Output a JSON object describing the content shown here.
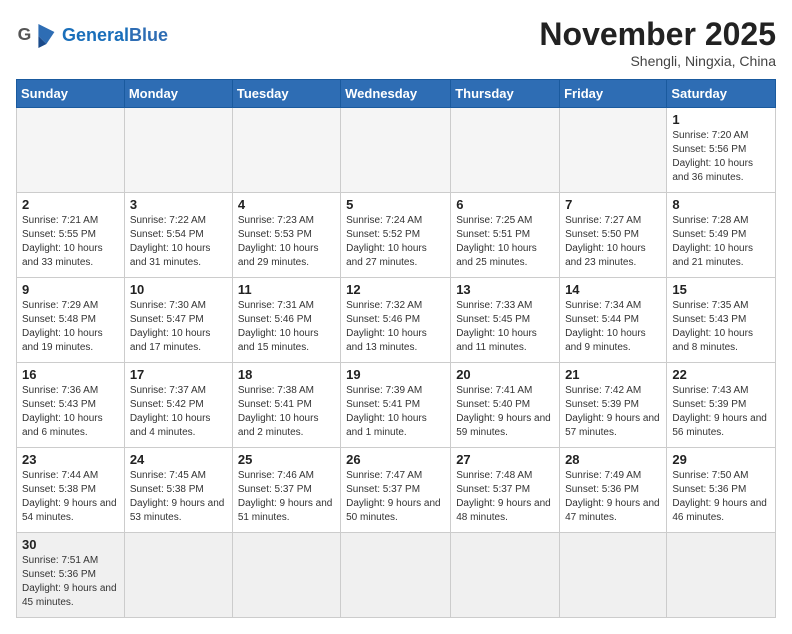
{
  "header": {
    "logo_text_general": "General",
    "logo_text_blue": "Blue",
    "month_title": "November 2025",
    "location": "Shengli, Ningxia, China"
  },
  "days_of_week": [
    "Sunday",
    "Monday",
    "Tuesday",
    "Wednesday",
    "Thursday",
    "Friday",
    "Saturday"
  ],
  "weeks": [
    [
      {
        "day": "",
        "empty": true
      },
      {
        "day": "",
        "empty": true
      },
      {
        "day": "",
        "empty": true
      },
      {
        "day": "",
        "empty": true
      },
      {
        "day": "",
        "empty": true
      },
      {
        "day": "",
        "empty": true
      },
      {
        "day": "1",
        "sunrise": "7:20 AM",
        "sunset": "5:56 PM",
        "daylight": "10 hours and 36 minutes."
      }
    ],
    [
      {
        "day": "2",
        "sunrise": "7:21 AM",
        "sunset": "5:55 PM",
        "daylight": "10 hours and 33 minutes."
      },
      {
        "day": "3",
        "sunrise": "7:22 AM",
        "sunset": "5:54 PM",
        "daylight": "10 hours and 31 minutes."
      },
      {
        "day": "4",
        "sunrise": "7:23 AM",
        "sunset": "5:53 PM",
        "daylight": "10 hours and 29 minutes."
      },
      {
        "day": "5",
        "sunrise": "7:24 AM",
        "sunset": "5:52 PM",
        "daylight": "10 hours and 27 minutes."
      },
      {
        "day": "6",
        "sunrise": "7:25 AM",
        "sunset": "5:51 PM",
        "daylight": "10 hours and 25 minutes."
      },
      {
        "day": "7",
        "sunrise": "7:27 AM",
        "sunset": "5:50 PM",
        "daylight": "10 hours and 23 minutes."
      },
      {
        "day": "8",
        "sunrise": "7:28 AM",
        "sunset": "5:49 PM",
        "daylight": "10 hours and 21 minutes."
      }
    ],
    [
      {
        "day": "9",
        "sunrise": "7:29 AM",
        "sunset": "5:48 PM",
        "daylight": "10 hours and 19 minutes."
      },
      {
        "day": "10",
        "sunrise": "7:30 AM",
        "sunset": "5:47 PM",
        "daylight": "10 hours and 17 minutes."
      },
      {
        "day": "11",
        "sunrise": "7:31 AM",
        "sunset": "5:46 PM",
        "daylight": "10 hours and 15 minutes."
      },
      {
        "day": "12",
        "sunrise": "7:32 AM",
        "sunset": "5:46 PM",
        "daylight": "10 hours and 13 minutes."
      },
      {
        "day": "13",
        "sunrise": "7:33 AM",
        "sunset": "5:45 PM",
        "daylight": "10 hours and 11 minutes."
      },
      {
        "day": "14",
        "sunrise": "7:34 AM",
        "sunset": "5:44 PM",
        "daylight": "10 hours and 9 minutes."
      },
      {
        "day": "15",
        "sunrise": "7:35 AM",
        "sunset": "5:43 PM",
        "daylight": "10 hours and 8 minutes."
      }
    ],
    [
      {
        "day": "16",
        "sunrise": "7:36 AM",
        "sunset": "5:43 PM",
        "daylight": "10 hours and 6 minutes."
      },
      {
        "day": "17",
        "sunrise": "7:37 AM",
        "sunset": "5:42 PM",
        "daylight": "10 hours and 4 minutes."
      },
      {
        "day": "18",
        "sunrise": "7:38 AM",
        "sunset": "5:41 PM",
        "daylight": "10 hours and 2 minutes."
      },
      {
        "day": "19",
        "sunrise": "7:39 AM",
        "sunset": "5:41 PM",
        "daylight": "10 hours and 1 minute."
      },
      {
        "day": "20",
        "sunrise": "7:41 AM",
        "sunset": "5:40 PM",
        "daylight": "9 hours and 59 minutes."
      },
      {
        "day": "21",
        "sunrise": "7:42 AM",
        "sunset": "5:39 PM",
        "daylight": "9 hours and 57 minutes."
      },
      {
        "day": "22",
        "sunrise": "7:43 AM",
        "sunset": "5:39 PM",
        "daylight": "9 hours and 56 minutes."
      }
    ],
    [
      {
        "day": "23",
        "sunrise": "7:44 AM",
        "sunset": "5:38 PM",
        "daylight": "9 hours and 54 minutes."
      },
      {
        "day": "24",
        "sunrise": "7:45 AM",
        "sunset": "5:38 PM",
        "daylight": "9 hours and 53 minutes."
      },
      {
        "day": "25",
        "sunrise": "7:46 AM",
        "sunset": "5:37 PM",
        "daylight": "9 hours and 51 minutes."
      },
      {
        "day": "26",
        "sunrise": "7:47 AM",
        "sunset": "5:37 PM",
        "daylight": "9 hours and 50 minutes."
      },
      {
        "day": "27",
        "sunrise": "7:48 AM",
        "sunset": "5:37 PM",
        "daylight": "9 hours and 48 minutes."
      },
      {
        "day": "28",
        "sunrise": "7:49 AM",
        "sunset": "5:36 PM",
        "daylight": "9 hours and 47 minutes."
      },
      {
        "day": "29",
        "sunrise": "7:50 AM",
        "sunset": "5:36 PM",
        "daylight": "9 hours and 46 minutes."
      }
    ],
    [
      {
        "day": "30",
        "sunrise": "7:51 AM",
        "sunset": "5:36 PM",
        "daylight": "9 hours and 45 minutes.",
        "last": true
      },
      {
        "day": "",
        "empty": true,
        "last": true
      },
      {
        "day": "",
        "empty": true,
        "last": true
      },
      {
        "day": "",
        "empty": true,
        "last": true
      },
      {
        "day": "",
        "empty": true,
        "last": true
      },
      {
        "day": "",
        "empty": true,
        "last": true
      },
      {
        "day": "",
        "empty": true,
        "last": true
      }
    ]
  ]
}
